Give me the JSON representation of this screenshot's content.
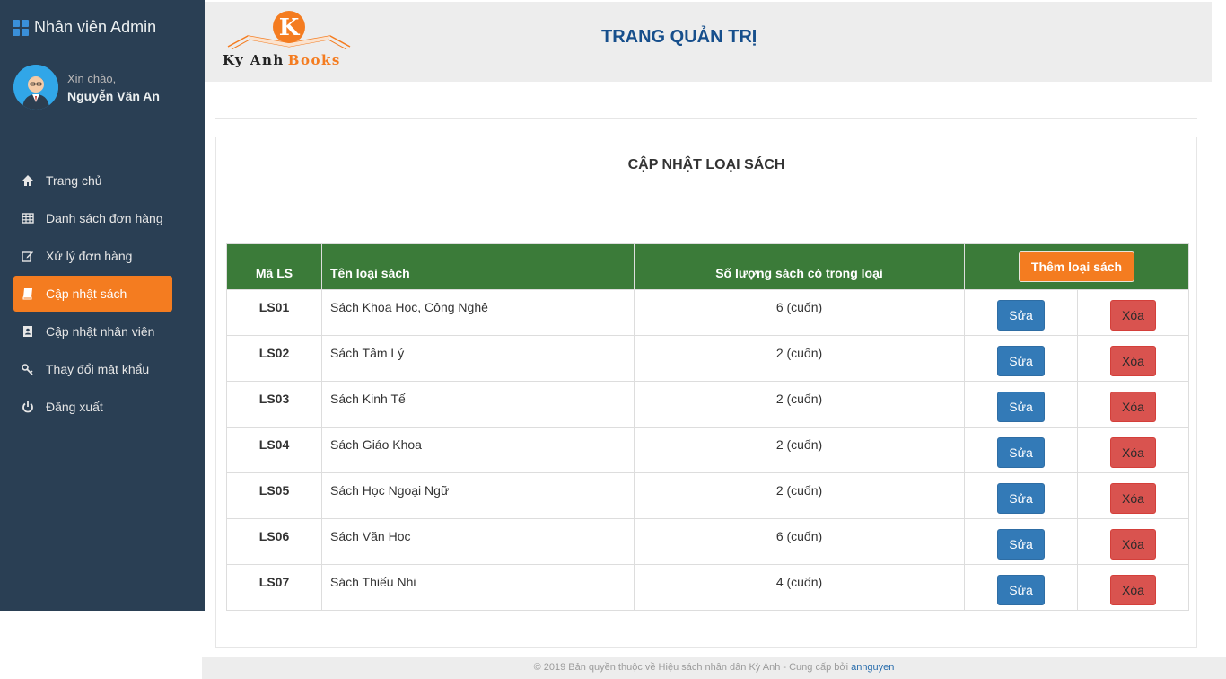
{
  "sidebar": {
    "brand_title": "Nhân viên Admin",
    "greeting": "Xin chào,",
    "username": "Nguyễn Văn An",
    "items": [
      {
        "label": "Trang chủ",
        "icon": "home-icon",
        "active": false
      },
      {
        "label": "Danh sách đơn hàng",
        "icon": "table-icon",
        "active": false
      },
      {
        "label": "Xử lý đơn hàng",
        "icon": "edit-icon",
        "active": false
      },
      {
        "label": "Cập nhật sách",
        "icon": "book-icon",
        "active": true
      },
      {
        "label": "Cập nhật nhân viên",
        "icon": "contact-book-icon",
        "active": false
      },
      {
        "label": "Thay đổi mật khẩu",
        "icon": "key-icon",
        "active": false
      },
      {
        "label": "Đăng xuất",
        "icon": "power-icon",
        "active": false
      }
    ]
  },
  "header": {
    "logo_word1": "Ky Anh",
    "logo_word2": "Books",
    "logo_letter": "K",
    "title": "TRANG QUẢN TRỊ"
  },
  "panel": {
    "title": "CẬP NHẬT LOẠI SÁCH",
    "columns": [
      "Mã LS",
      "Tên loại sách",
      "Số lượng sách có trong loại"
    ],
    "add_button": "Thêm loại sách",
    "edit_label": "Sửa",
    "delete_label": "Xóa",
    "rows": [
      {
        "code": "LS01",
        "name": "Sách Khoa Học, Công Nghệ",
        "qty": "6 (cuốn)"
      },
      {
        "code": "LS02",
        "name": "Sách Tâm Lý",
        "qty": "2 (cuốn)"
      },
      {
        "code": "LS03",
        "name": "Sách Kinh Tế",
        "qty": "2 (cuốn)"
      },
      {
        "code": "LS04",
        "name": "Sách Giáo Khoa",
        "qty": "2 (cuốn)"
      },
      {
        "code": "LS05",
        "name": "Sách Học Ngoại Ngữ",
        "qty": "2 (cuốn)"
      },
      {
        "code": "LS06",
        "name": "Sách Văn Học",
        "qty": "6 (cuốn)"
      },
      {
        "code": "LS07",
        "name": "Sách Thiếu Nhi",
        "qty": "4 (cuốn)"
      }
    ]
  },
  "footer": {
    "text": "© 2019 Bản quyền thuộc về Hiệu sách nhân dân Kỳ Anh - Cung cấp bởi ",
    "link": "annguyen"
  },
  "colors": {
    "sidebar_bg": "#2a3f54",
    "accent": "#f47c20",
    "table_header": "#3b7b39",
    "edit_button": "#337ab7",
    "delete_button": "#d9534f",
    "heading_blue": "#174f8c"
  }
}
